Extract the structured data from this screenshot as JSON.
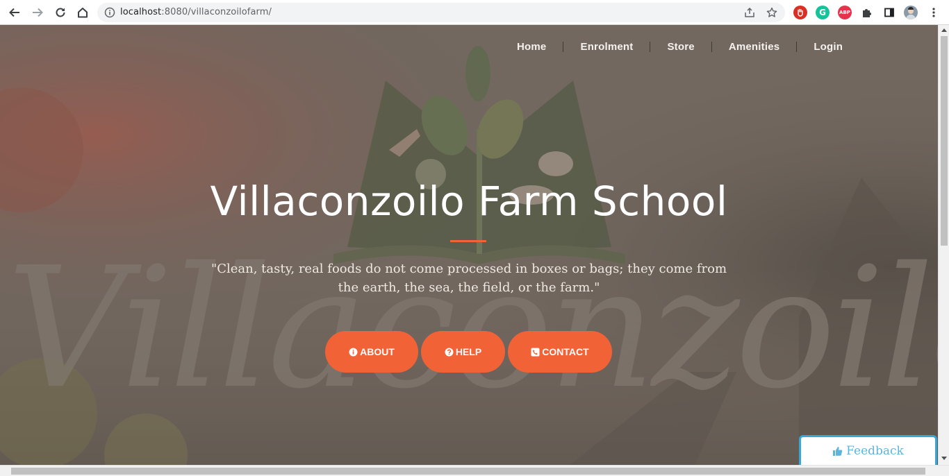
{
  "browser": {
    "url_host": "localhost",
    "url_rest": ":8080/villaconzoilofarm/",
    "icons": {
      "back": "arrow-left-icon",
      "forward": "arrow-right-icon",
      "reload": "reload-icon",
      "home": "home-icon",
      "site_info": "info-icon",
      "share": "share-icon",
      "bookmark": "star-icon",
      "extensions": "puzzle-icon",
      "side_panel": "side-panel-icon",
      "menu": "kebab-menu-icon"
    },
    "extension_badges": {
      "abp": "ABP",
      "grammarly": "G"
    }
  },
  "nav": {
    "items": [
      {
        "label": "Home"
      },
      {
        "label": "Enrolment"
      },
      {
        "label": "Store"
      },
      {
        "label": "Amenities"
      },
      {
        "label": "Login"
      }
    ]
  },
  "hero": {
    "title": "Villaconzoilo Farm School",
    "quote_line1": "\"Clean, tasty, real foods do not come processed in boxes or bags; they come from",
    "quote_line2": "the earth, the sea, the field, or the farm.\"",
    "background_script_text": "Villaconzoilo"
  },
  "buttons": {
    "about": "ABOUT",
    "help": "HELP",
    "contact": "CONTACT"
  },
  "feedback": {
    "label": "Feedback"
  },
  "colors": {
    "accent": "#f26237",
    "feedback_border": "#38a6d7",
    "feedback_text": "#5fb4dc"
  }
}
